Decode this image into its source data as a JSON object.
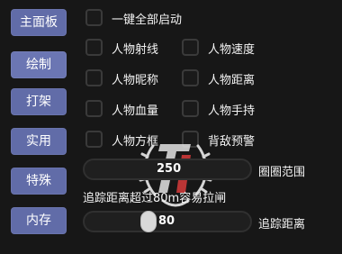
{
  "sidebar": {
    "items": [
      {
        "label": "主面板"
      },
      {
        "label": "绘制"
      },
      {
        "label": "打架"
      },
      {
        "label": "实用"
      },
      {
        "label": "特殊"
      },
      {
        "label": "内存"
      }
    ]
  },
  "options": {
    "start_all": "一键全部启动",
    "player_line": "人物射线",
    "player_speed": "人物速度",
    "player_nickname": "人物昵称",
    "player_distance": "人物距离",
    "player_health": "人物血量",
    "player_holding": "人物手持",
    "player_box": "人物方框",
    "back_warning": "背敌预警"
  },
  "sliders": {
    "circle_range": {
      "label": "圈圈范围",
      "value": "250"
    },
    "track_distance": {
      "label": "追踪距离",
      "value": "80"
    }
  },
  "notes": {
    "track_warning": "追踪距离超过80m容易拉闸"
  },
  "colors": {
    "sidebar_button": "#616ca8",
    "background": "#171717"
  }
}
